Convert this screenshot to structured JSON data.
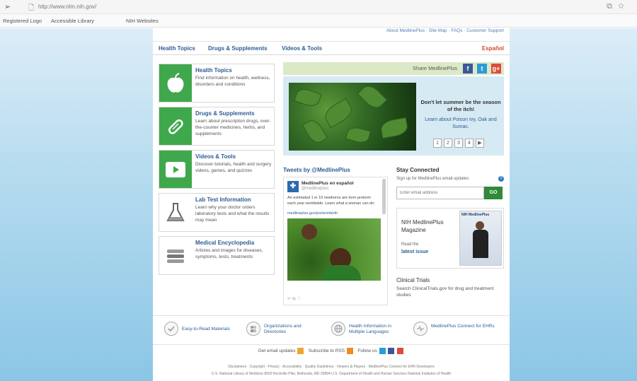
{
  "browser": {
    "url": "http://www.nlm.nih.gov/",
    "bookmarks": [
      "Registered Logo",
      "Accessible Library",
      "NIH Websites"
    ]
  },
  "header": {
    "top_links": "About MedlinePlus · Site Map · FAQs · Customer Support",
    "nav": [
      "Health Topics",
      "Drugs & Supplements",
      "Videos & Tools"
    ],
    "espanol": "Español"
  },
  "cards": [
    {
      "title": "Health Topics",
      "desc": "Find information on health, wellness, disorders and conditions",
      "icon": "apple-icon"
    },
    {
      "title": "Drugs & Supplements",
      "desc": "Learn about prescription drugs, over-the-counter medicines, herbs, and supplements",
      "icon": "pill-icon"
    },
    {
      "title": "Videos & Tools",
      "desc": "Discover tutorials, health and surgery videos, games, and quizzes",
      "icon": "play-icon"
    },
    {
      "title": "Lab Test Information",
      "desc": "Learn why your doctor orders laboratory tests and what the results may mean",
      "icon": "flask-icon"
    },
    {
      "title": "Medical Encyclopedia",
      "desc": "Articles and images for diseases, symptoms, tests, treatments",
      "icon": "book-icon"
    }
  ],
  "share": {
    "label": "Share MedlinePlus",
    "facebook": "f",
    "twitter": "t",
    "google": "g+"
  },
  "feature": {
    "headline": "Don't let summer be the season of the itch!",
    "sub": "Learn about Poison Ivy, Oak and Sumac.",
    "pages": [
      "1",
      "2",
      "3",
      "4",
      "▶"
    ]
  },
  "tweets": {
    "title": "Tweets by @MedlinePlus",
    "name": "MedlinePlus en español",
    "handle": "@medlineplus",
    "text": "An estimated 1 in 10 newborns are born preterm each year worldwide. Learn what a woman can do:",
    "link": "medlineplus.gov/pretermbirth",
    "actions": "↩ ⇆ ♡"
  },
  "connected": {
    "title": "Stay Connected",
    "desc": "Sign up for MedlinePlus email updates",
    "placeholder": "Enter email address",
    "go": "GO"
  },
  "magazine": {
    "title": "NIH MedlinePlus Magazine",
    "read": "Read the",
    "latest": "latest issue",
    "cover_title": "NIH MedlinePlus"
  },
  "trials": {
    "title": "Clinical Trials",
    "desc": "Search ClinicalTrials.gov for drug and treatment studies"
  },
  "bottom": [
    {
      "label": "Easy-to-Read Materials",
      "icon": "check-icon"
    },
    {
      "label": "Organizations and Directories",
      "icon": "people-icon"
    },
    {
      "label": "Health Information in Multiple Languages",
      "icon": "globe-icon"
    },
    {
      "label": "MedlinePlus Connect for EHRs",
      "icon": "connect-icon"
    }
  ],
  "follow": {
    "get_updates": "Get email updates",
    "subscribe": "Subscribe to RSS",
    "follow": "Follow us"
  },
  "footer": {
    "line1": "Disclaimers · Copyright · Privacy · Accessibility · Quality Guidelines · Viewers & Players · MedlinePlus Connect for EHR Developers",
    "line2": "U.S. National Library of Medicine 8600 Rockville Pike, Bethesda, MD 20894 U.S. Department of Health and Human Services National Institutes of Health"
  },
  "colors": {
    "green": "#3fa84c",
    "link": "#2c5d94",
    "espanol": "#d04a2a",
    "bg": "#8bc6e6"
  }
}
